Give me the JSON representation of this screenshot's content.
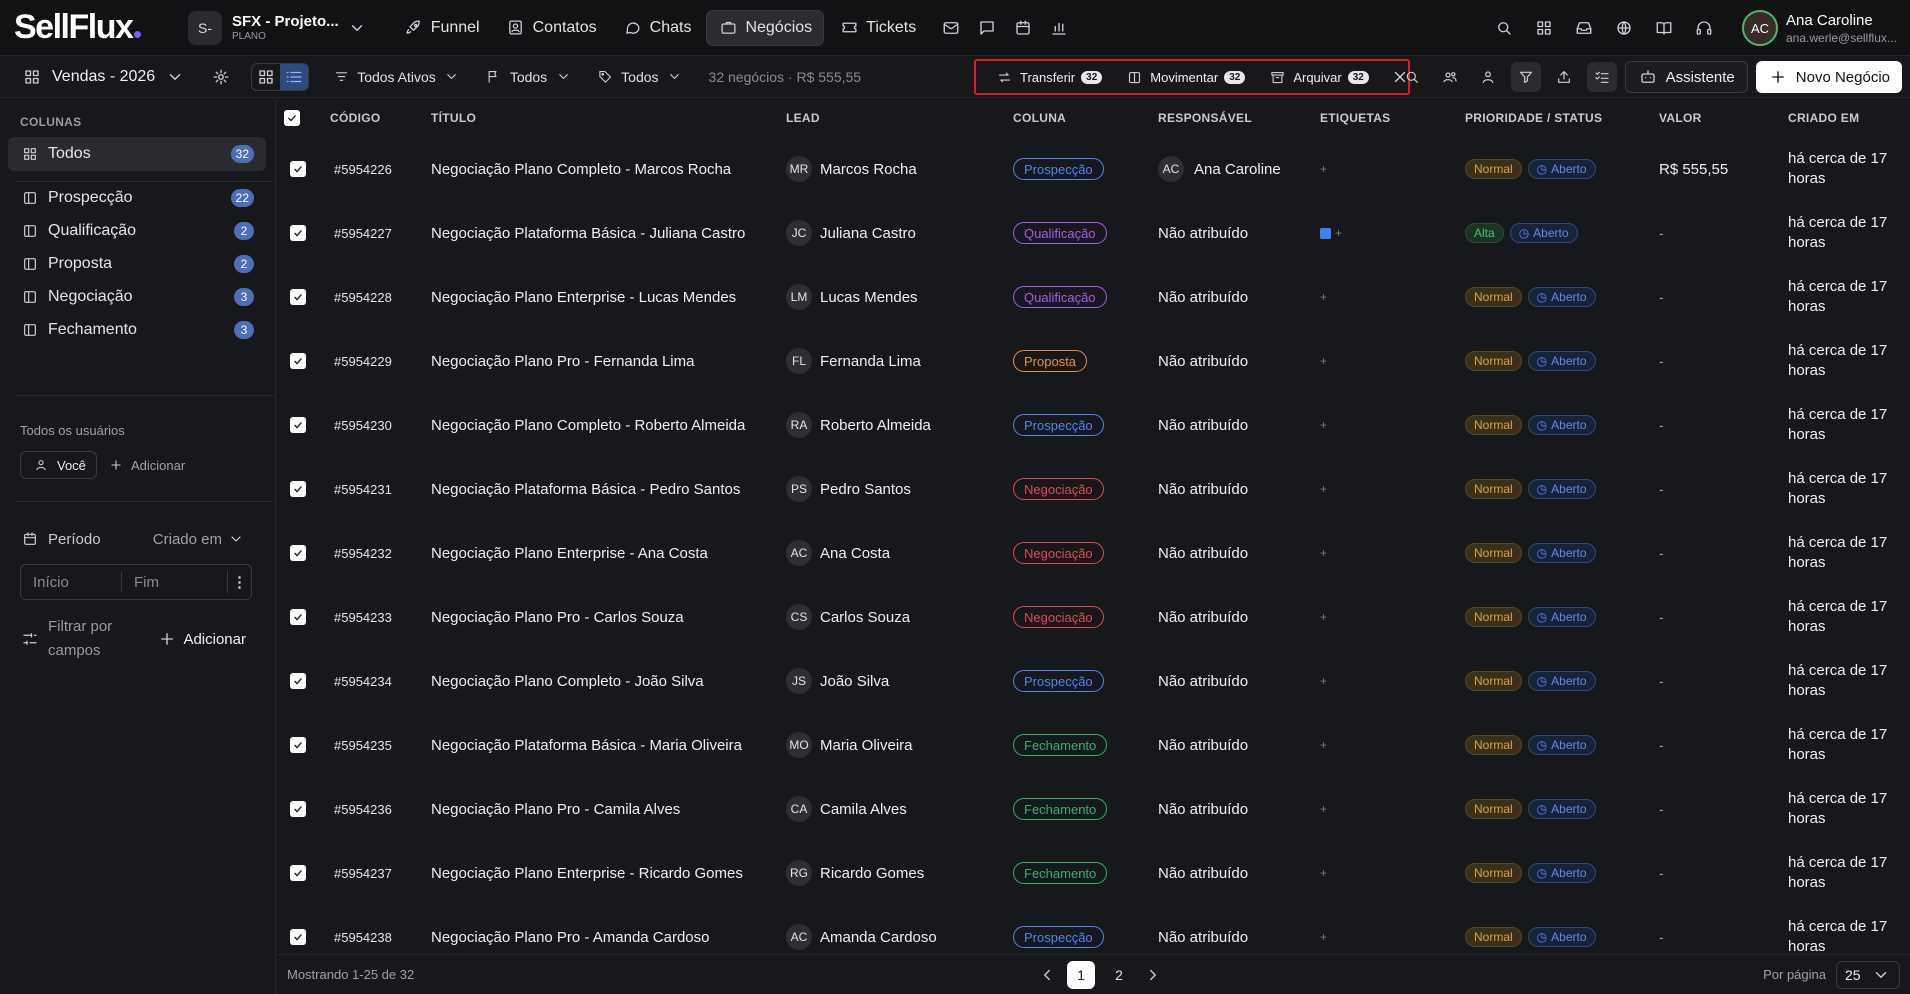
{
  "app": {
    "logo": "SellFlux"
  },
  "project": {
    "initial": "S-",
    "name": "SFX - Projeto...",
    "plan": "PLANO"
  },
  "nav": [
    {
      "label": "Funnel",
      "icon": "rocket-icon"
    },
    {
      "label": "Contatos",
      "icon": "contacts-icon"
    },
    {
      "label": "Chats",
      "icon": "chat-icon"
    },
    {
      "label": "Negócios",
      "icon": "briefcase-icon",
      "active": true
    },
    {
      "label": "Tickets",
      "icon": "ticket-icon"
    }
  ],
  "user": {
    "name": "Ana Caroline",
    "email": "ana.werle@sellflux..."
  },
  "toolbar": {
    "pipeline": "Vendas - 2026",
    "filter_status": "Todos Ativos",
    "filter_flag": "Todos",
    "filter_tag": "Todos",
    "summary": "32 negócios · R$ 555,55",
    "bulk": {
      "transfer": "Transferir",
      "transfer_count": "32",
      "move": "Movimentar",
      "move_count": "32",
      "archive": "Arquivar",
      "archive_count": "32"
    },
    "assistant": "Assistente",
    "new_deal": "Novo Negócio"
  },
  "sidebar": {
    "columns_header": "COLUNAS",
    "items": [
      {
        "label": "Todos",
        "count": "32",
        "active": true
      },
      {
        "label": "Prospecção",
        "count": "22"
      },
      {
        "label": "Qualificação",
        "count": "2"
      },
      {
        "label": "Proposta",
        "count": "2"
      },
      {
        "label": "Negociação",
        "count": "3"
      },
      {
        "label": "Fechamento",
        "count": "3"
      }
    ],
    "users_label": "Todos os usuários",
    "you": "Você",
    "add_user": "Adicionar",
    "period": "Período",
    "period_select": "Criado em",
    "start": "Início",
    "end": "Fim",
    "filter_fields": "Filtrar por campos",
    "add_filter": "Adicionar"
  },
  "table": {
    "headers": [
      "CÓDIGO",
      "TÍTULO",
      "LEAD",
      "COLUNA",
      "RESPONSÁVEL",
      "ETIQUETAS",
      "PRIORIDADE / STATUS",
      "VALOR",
      "CRIADO EM"
    ],
    "rows": [
      {
        "code": "#5954226",
        "title": "Negociação Plano Completo - Marcos Rocha",
        "lead_initials": "MR",
        "lead": "Marcos Rocha",
        "stage": "Prospecção",
        "resp_initials": "AC",
        "resp": "Ana Caroline",
        "tag": false,
        "priority": "Normal",
        "status": "Aberto",
        "value": "R$ 555,55",
        "created": "há cerca de 17 horas"
      },
      {
        "code": "#5954227",
        "title": "Negociação Plataforma Básica - Juliana Castro",
        "lead_initials": "JC",
        "lead": "Juliana Castro",
        "stage": "Qualificação",
        "resp_initials": "",
        "resp": "Não atribuído",
        "tag": true,
        "priority": "Alta",
        "status": "Aberto",
        "value": "-",
        "created": "há cerca de 17 horas"
      },
      {
        "code": "#5954228",
        "title": "Negociação Plano Enterprise - Lucas Mendes",
        "lead_initials": "LM",
        "lead": "Lucas Mendes",
        "stage": "Qualificação",
        "resp_initials": "",
        "resp": "Não atribuído",
        "tag": false,
        "priority": "Normal",
        "status": "Aberto",
        "value": "-",
        "created": "há cerca de 17 horas"
      },
      {
        "code": "#5954229",
        "title": "Negociação Plano Pro - Fernanda Lima",
        "lead_initials": "FL",
        "lead": "Fernanda Lima",
        "stage": "Proposta",
        "resp_initials": "",
        "resp": "Não atribuído",
        "tag": false,
        "priority": "Normal",
        "status": "Aberto",
        "value": "-",
        "created": "há cerca de 17 horas"
      },
      {
        "code": "#5954230",
        "title": "Negociação Plano Completo - Roberto Almeida",
        "lead_initials": "RA",
        "lead": "Roberto Almeida",
        "stage": "Prospecção",
        "resp_initials": "",
        "resp": "Não atribuído",
        "tag": false,
        "priority": "Normal",
        "status": "Aberto",
        "value": "-",
        "created": "há cerca de 17 horas"
      },
      {
        "code": "#5954231",
        "title": "Negociação Plataforma Básica - Pedro Santos",
        "lead_initials": "PS",
        "lead": "Pedro Santos",
        "stage": "Negociação",
        "resp_initials": "",
        "resp": "Não atribuído",
        "tag": false,
        "priority": "Normal",
        "status": "Aberto",
        "value": "-",
        "created": "há cerca de 17 horas"
      },
      {
        "code": "#5954232",
        "title": "Negociação Plano Enterprise - Ana Costa",
        "lead_initials": "AC",
        "lead": "Ana Costa",
        "stage": "Negociação",
        "resp_initials": "",
        "resp": "Não atribuído",
        "tag": false,
        "priority": "Normal",
        "status": "Aberto",
        "value": "-",
        "created": "há cerca de 17 horas"
      },
      {
        "code": "#5954233",
        "title": "Negociação Plano Pro - Carlos Souza",
        "lead_initials": "CS",
        "lead": "Carlos Souza",
        "stage": "Negociação",
        "resp_initials": "",
        "resp": "Não atribuído",
        "tag": false,
        "priority": "Normal",
        "status": "Aberto",
        "value": "-",
        "created": "há cerca de 17 horas"
      },
      {
        "code": "#5954234",
        "title": "Negociação Plano Completo - João Silva",
        "lead_initials": "JS",
        "lead": "João Silva",
        "stage": "Prospecção",
        "resp_initials": "",
        "resp": "Não atribuído",
        "tag": false,
        "priority": "Normal",
        "status": "Aberto",
        "value": "-",
        "created": "há cerca de 17 horas"
      },
      {
        "code": "#5954235",
        "title": "Negociação Plataforma Básica - Maria Oliveira",
        "lead_initials": "MO",
        "lead": "Maria Oliveira",
        "stage": "Fechamento",
        "resp_initials": "",
        "resp": "Não atribuído",
        "tag": false,
        "priority": "Normal",
        "status": "Aberto",
        "value": "-",
        "created": "há cerca de 17 horas"
      },
      {
        "code": "#5954236",
        "title": "Negociação Plano Pro - Camila Alves",
        "lead_initials": "CA",
        "lead": "Camila Alves",
        "stage": "Fechamento",
        "resp_initials": "",
        "resp": "Não atribuído",
        "tag": false,
        "priority": "Normal",
        "status": "Aberto",
        "value": "-",
        "created": "há cerca de 17 horas"
      },
      {
        "code": "#5954237",
        "title": "Negociação Plano Enterprise - Ricardo Gomes",
        "lead_initials": "RG",
        "lead": "Ricardo Gomes",
        "stage": "Fechamento",
        "resp_initials": "",
        "resp": "Não atribuído",
        "tag": false,
        "priority": "Normal",
        "status": "Aberto",
        "value": "-",
        "created": "há cerca de 17 horas"
      },
      {
        "code": "#5954238",
        "title": "Negociação Plano Pro - Amanda Cardoso",
        "lead_initials": "AC",
        "lead": "Amanda Cardoso",
        "stage": "Prospecção",
        "resp_initials": "",
        "resp": "Não atribuído",
        "tag": false,
        "priority": "Normal",
        "status": "Aberto",
        "value": "-",
        "created": "há cerca de 17 horas"
      }
    ]
  },
  "stage_colors": {
    "Prospecção": "#4f86f7",
    "Qualificação": "#a65cf0",
    "Proposta": "#f08a3c",
    "Negociação": "#e5484d",
    "Fechamento": "#30b36b"
  },
  "footer": {
    "showing": "Mostrando 1-25 de 32",
    "pages": [
      "1",
      "2"
    ],
    "current_page": "1",
    "per_page_label": "Por página",
    "per_page": "25"
  }
}
